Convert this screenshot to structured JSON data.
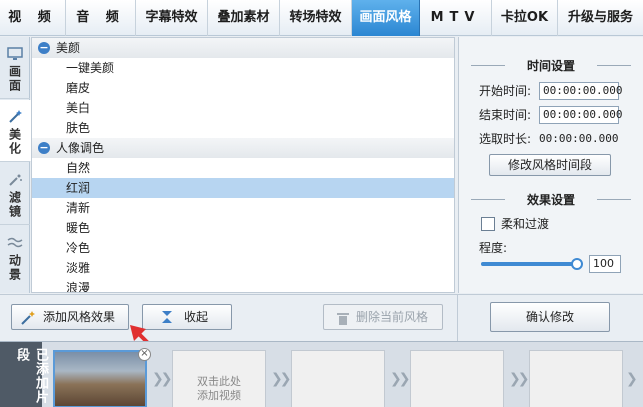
{
  "top_tabs": [
    {
      "label": "视 频"
    },
    {
      "label": "音 频"
    },
    {
      "label": "字幕特效"
    },
    {
      "label": "叠加素材"
    },
    {
      "label": "转场特效"
    },
    {
      "label": "画面风格"
    },
    {
      "label": "MTV"
    },
    {
      "label": "卡拉OK"
    },
    {
      "label": "升级与服务"
    }
  ],
  "left_tabs": [
    {
      "label": "画面",
      "icon": "monitor-icon"
    },
    {
      "label": "美化",
      "icon": "magic-wand-icon"
    },
    {
      "label": "滤镜",
      "icon": "sparkle-wand-icon"
    },
    {
      "label": "动景",
      "icon": "wave-icon"
    }
  ],
  "tree": {
    "groups": [
      {
        "label": "美颜",
        "items": [
          "一键美颜",
          "磨皮",
          "美白",
          "肤色"
        ]
      },
      {
        "label": "人像调色",
        "items": [
          "自然",
          "红润",
          "清新",
          "暖色",
          "冷色",
          "淡雅",
          "浪漫"
        ]
      }
    ],
    "selected": "红润"
  },
  "time_settings": {
    "header": "时间设置",
    "start_label": "开始时间:",
    "start_value": "00:00:00.000",
    "end_label": "结束时间:",
    "end_value": "00:00:00.000",
    "duration_label": "选取时长:",
    "duration_value": "00:00:00.000",
    "modify_button": "修改风格时间段"
  },
  "effect_settings": {
    "header": "效果设置",
    "soft_transition_label": "柔和过渡",
    "soft_transition_checked": false,
    "degree_label": "程度:",
    "degree_value": "100",
    "degree_percent": 100
  },
  "buttons": {
    "add_effect": "添加风格效果",
    "collapse": "收起",
    "delete_current": "删除当前风格",
    "confirm": "确认修改"
  },
  "strip": {
    "tab_label": "已添加片段",
    "add_hint_line1": "双击此处",
    "add_hint_line2": "添加视频"
  },
  "colors": {
    "active_tab": "#2b86d2",
    "selected_row": "#b7d5f1",
    "annotation_arrow": "#e03030"
  }
}
